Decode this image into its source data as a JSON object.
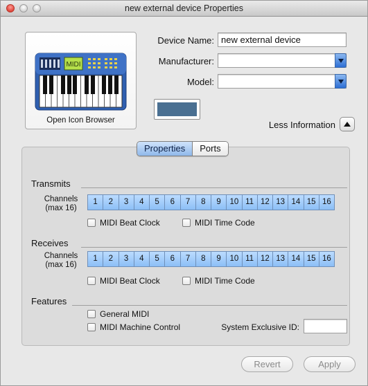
{
  "window": {
    "title": "new external device Properties"
  },
  "icon": {
    "caption": "Open Icon Browser",
    "screen_text": "MIDI",
    "color_well": "#4a7092"
  },
  "form": {
    "device_name_label": "Device Name:",
    "device_name_value": "new external device",
    "manufacturer_label": "Manufacturer:",
    "manufacturer_value": "",
    "model_label": "Model:",
    "model_value": "",
    "less_info_label": "Less Information"
  },
  "tabs": [
    {
      "label": "Properties",
      "selected": true
    },
    {
      "label": "Ports",
      "selected": false
    }
  ],
  "transmits": {
    "title": "Transmits",
    "channels_label_1": "Channels",
    "channels_label_2": "(max 16)",
    "channels": [
      "1",
      "2",
      "3",
      "4",
      "5",
      "6",
      "7",
      "8",
      "9",
      "10",
      "11",
      "12",
      "13",
      "14",
      "15",
      "16"
    ],
    "beat_clock": "MIDI Beat Clock",
    "time_code": "MIDI Time Code"
  },
  "receives": {
    "title": "Receives",
    "channels_label_1": "Channels",
    "channels_label_2": "(max 16)",
    "channels": [
      "1",
      "2",
      "3",
      "4",
      "5",
      "6",
      "7",
      "8",
      "9",
      "10",
      "11",
      "12",
      "13",
      "14",
      "15",
      "16"
    ],
    "beat_clock": "MIDI Beat Clock",
    "time_code": "MIDI Time Code"
  },
  "features": {
    "title": "Features",
    "general_midi": "General MIDI",
    "machine_control": "MIDI Machine Control",
    "sysex_label": "System Exclusive ID:",
    "sysex_value": ""
  },
  "buttons": {
    "revert": "Revert",
    "apply": "Apply"
  }
}
